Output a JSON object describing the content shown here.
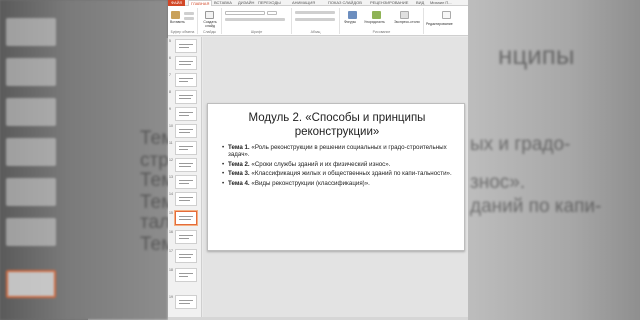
{
  "ribbon": {
    "file_tab": "ФАЙЛ",
    "tabs": [
      "ГЛАВНАЯ",
      "ВСТАВКА",
      "ДИЗАЙН",
      "ПЕРЕХОДЫ",
      "АНИМАЦИЯ",
      "ПОКАЗ СЛАЙДОВ",
      "РЕЦЕНЗИРОВАНИЕ",
      "ВИД"
    ],
    "user": "Михаил П...",
    "groups": {
      "clipboard": "Буфер обмена",
      "slides": "Слайды",
      "font": "Шрифт",
      "paragraph": "Абзац",
      "drawing": "Рисование",
      "editing": "Редактирование"
    },
    "buttons": {
      "paste": "Вставить",
      "new_slide": "Создать слайд",
      "shapes": "Фигуры",
      "arrange": "Упорядочить",
      "quick_styles": "Экспресс-стили"
    }
  },
  "thumbnails": {
    "numbers": [
      "5",
      "6",
      "7",
      "8",
      "9",
      "10",
      "11",
      "12",
      "13",
      "14",
      "15",
      "16",
      "17",
      "18",
      "19"
    ],
    "selected_index": 10
  },
  "slide": {
    "title_line1": "Модуль 2. «Способы и принципы",
    "title_line2": "реконструкции»",
    "bullets": [
      {
        "label": "Тема 1.",
        "text": " «Роль реконструкции в решении социальных и градо-строительных задач»."
      },
      {
        "label": "Тема 2.",
        "text": " «Сроки службы зданий и их физический износ»."
      },
      {
        "label": "Тема 3.",
        "text": " «Классификация жилых и общественных зданий по капи-тальности»."
      },
      {
        "label": "Тема 4.",
        "text": " «Виды реконструкции (классификация)»."
      }
    ]
  },
  "background": {
    "title_fragment": "нципы",
    "lines": [
      "Тема",
      "строи",
      "Тема",
      "Тема",
      "тальн",
      "Тема"
    ],
    "right_fragments": [
      "ых и градо-",
      "знос».",
      "даний по капи-"
    ]
  },
  "colors": {
    "accent": "#d24726",
    "selection": "#e46b3a"
  }
}
